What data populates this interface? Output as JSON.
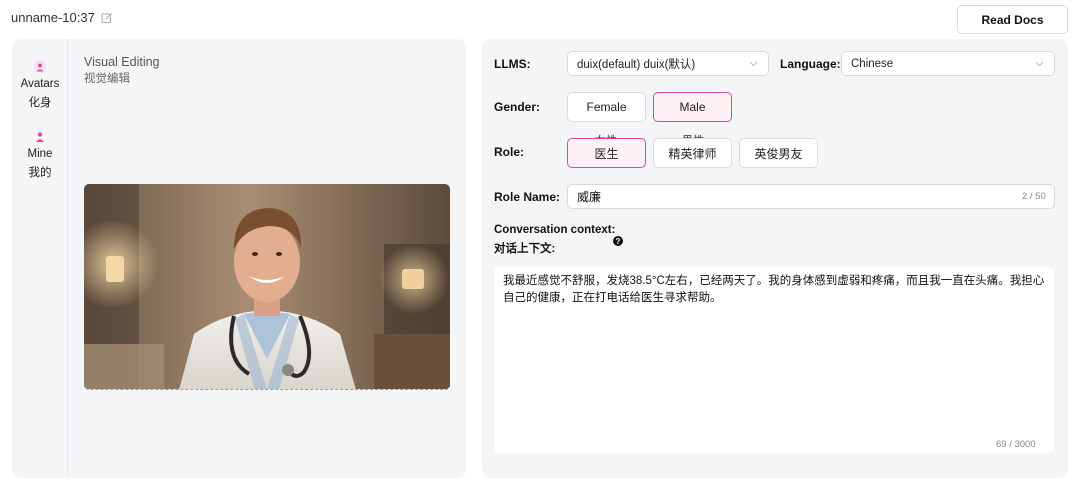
{
  "header": {
    "title": "unname-10:37",
    "read_docs_label": "Read Docs"
  },
  "sidebar": {
    "items": [
      {
        "label_en": "Avatars",
        "label_zh": "化身",
        "icon": "avatar-icon"
      },
      {
        "label_en": "Mine",
        "label_zh": "我的",
        "icon": "user-icon"
      }
    ]
  },
  "editor": {
    "title": "Visual Editing",
    "subtitle": "视觉编辑"
  },
  "form": {
    "llms_label": "LLMS:",
    "llms_value": "duix(default) duix(默认)",
    "language_label": "Language:",
    "language_value": "Chinese",
    "gender_label": "Gender:",
    "gender_options": [
      {
        "label": "Female",
        "sub": "女性",
        "selected": false
      },
      {
        "label": "Male",
        "sub": "男性",
        "selected": true
      }
    ],
    "role_label": "Role:",
    "role_options": [
      {
        "label": "医生",
        "selected": true
      },
      {
        "label": "精英律师",
        "selected": false
      },
      {
        "label": "英俊男友",
        "selected": false
      }
    ],
    "role_name_label": "Role Name:",
    "role_name_value": "威廉",
    "role_name_counter": "2 / 50",
    "context_label": "Conversation context:",
    "context_label_zh": "对话上下文:",
    "context_help_icon": "question-icon",
    "context_value": "我最近感觉不舒服，发烧38.5°C左右，已经两天了。我的身体感到虚弱和疼痛，而且我一直在头痛。我担心自己的健康，正在打电话给医生寻求帮助。",
    "context_counter": "69 / 3000"
  },
  "colors": {
    "accent": "#e0489a",
    "selected_bg": "#fdf1f6",
    "panel_bg": "#f4f5f7"
  }
}
